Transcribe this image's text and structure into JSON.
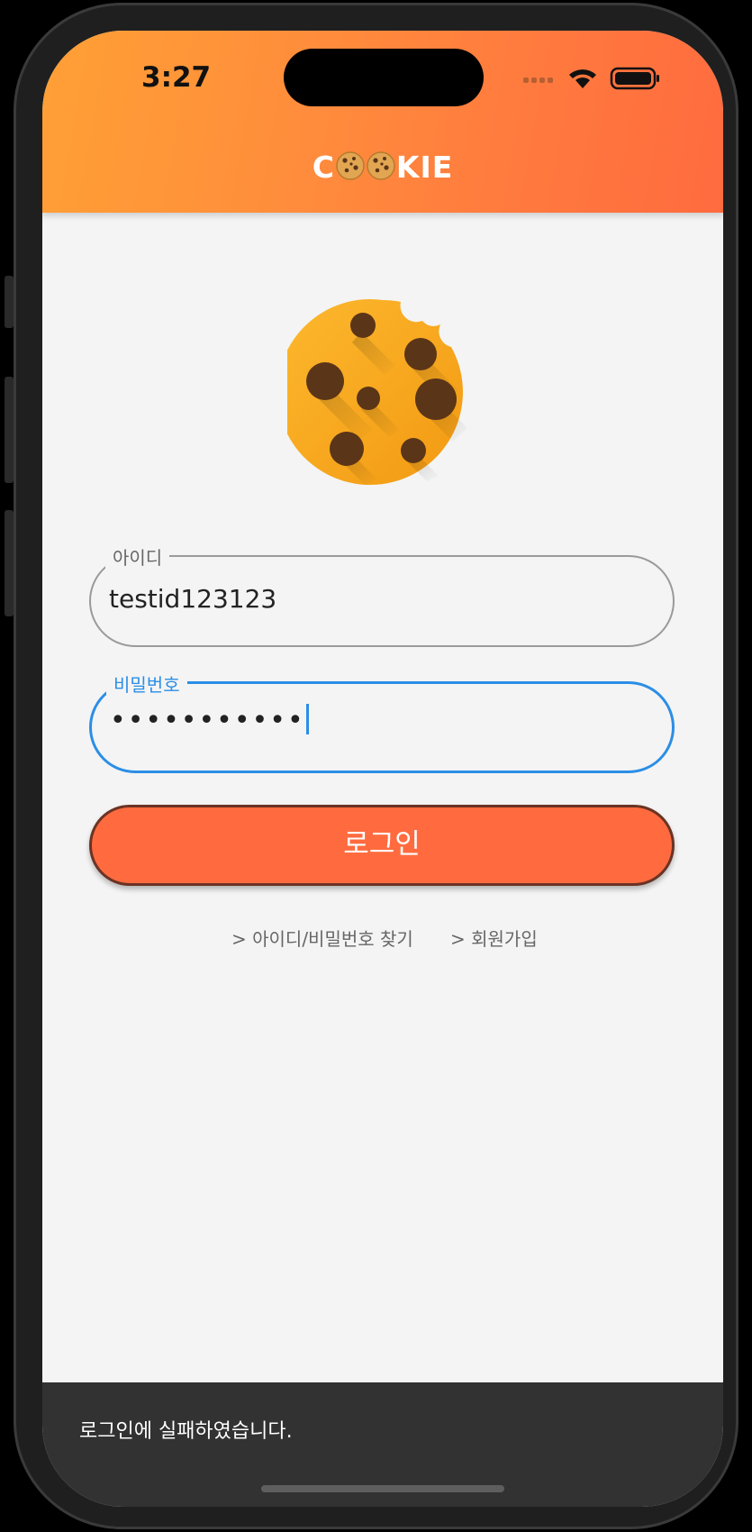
{
  "status_bar": {
    "time": "3:27"
  },
  "app_bar": {
    "title_prefix": "C",
    "title_icons": [
      "cookie-icon",
      "cookie-icon"
    ],
    "title_suffix": "KIE"
  },
  "logo": {
    "icon": "cookie-icon"
  },
  "form": {
    "id_field": {
      "label": "아이디",
      "value": "testid123123"
    },
    "password_field": {
      "label": "비밀번호",
      "value": "•••••••••••"
    },
    "login_button": "로그인"
  },
  "links": {
    "find_account": "> 아이디/비밀번호 찾기",
    "sign_up": "> 회원가입"
  },
  "snackbar": {
    "message": "로그인에 실패하였습니다."
  },
  "colors": {
    "header_start": "#ffa035",
    "header_end": "#ff6b3f",
    "accent_blue": "#2b8ee6",
    "button": "#ff6b3f",
    "snackbar": "#323232"
  }
}
